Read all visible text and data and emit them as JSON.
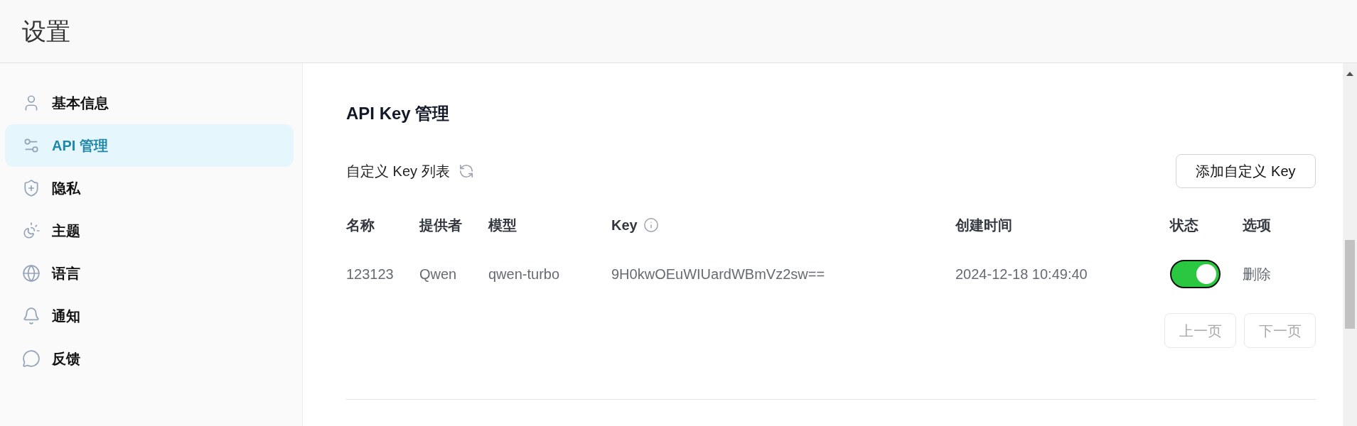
{
  "header": {
    "title": "设置"
  },
  "sidebar": {
    "items": [
      {
        "label": "基本信息",
        "selected": false
      },
      {
        "label": "API 管理",
        "selected": true
      },
      {
        "label": "隐私",
        "selected": false
      },
      {
        "label": "主题",
        "selected": false
      },
      {
        "label": "语言",
        "selected": false
      },
      {
        "label": "通知",
        "selected": false
      },
      {
        "label": "反馈",
        "selected": false
      }
    ]
  },
  "section": {
    "title": "API Key 管理",
    "list_title": "自定义 Key 列表",
    "add_button": "添加自定义 Key"
  },
  "table": {
    "columns": [
      "名称",
      "提供者",
      "模型",
      "Key",
      "创建时间",
      "状态",
      "选项"
    ],
    "rows": [
      {
        "name": "123123",
        "provider": "Qwen",
        "model": "qwen-turbo",
        "key": "9H0kwOEuWIUardWBmVz2sw==",
        "created": "2024-12-18 10:49:40",
        "enabled": true,
        "action": "删除"
      }
    ]
  },
  "pagination": {
    "prev": {
      "label": "上一页",
      "disabled": true
    },
    "next": {
      "label": "下一页",
      "disabled": true
    }
  }
}
